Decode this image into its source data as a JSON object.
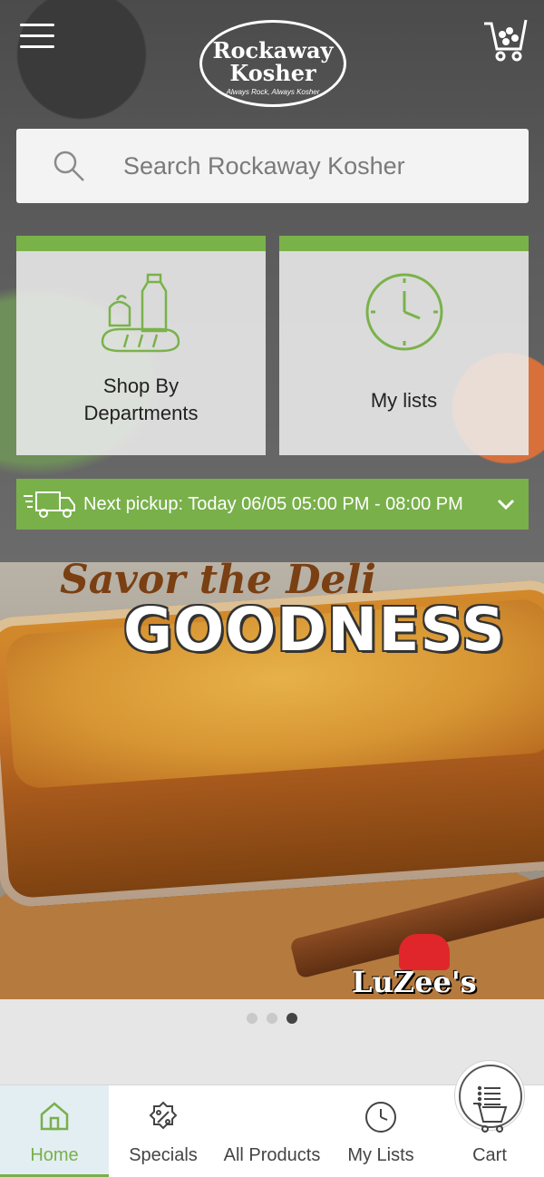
{
  "header": {
    "logo_line1": "Rockaway",
    "logo_line2": "Kosher",
    "logo_tagline": "Always Rock, Always Kosher"
  },
  "search": {
    "placeholder": "Search Rockaway Kosher"
  },
  "tiles": [
    {
      "label_line1": "Shop By",
      "label_line2": "Departments",
      "icon": "groceries-icon"
    },
    {
      "label": "My lists",
      "icon": "clock-icon"
    }
  ],
  "pickup": {
    "text": "Next pickup: Today 06/05 05:00 PM - 08:00 PM",
    "icon": "delivery-truck-icon"
  },
  "banner": {
    "script_text": "Savor the Deli",
    "headline": "GOODNESS",
    "brand": "LuZee's"
  },
  "carousel": {
    "count": 3,
    "active_index": 2
  },
  "nav": {
    "items": [
      {
        "label": "Home",
        "icon": "home-icon",
        "active": true
      },
      {
        "label": "Specials",
        "icon": "percent-badge-icon",
        "active": false
      },
      {
        "label": "All Products",
        "icon": "list-icon",
        "active": false
      },
      {
        "label": "My Lists",
        "icon": "clock-icon",
        "active": false
      },
      {
        "label": "Cart",
        "icon": "cart-icon",
        "active": false
      }
    ]
  },
  "colors": {
    "accent": "#79b04a",
    "active_nav_bg": "#e3eef3"
  }
}
